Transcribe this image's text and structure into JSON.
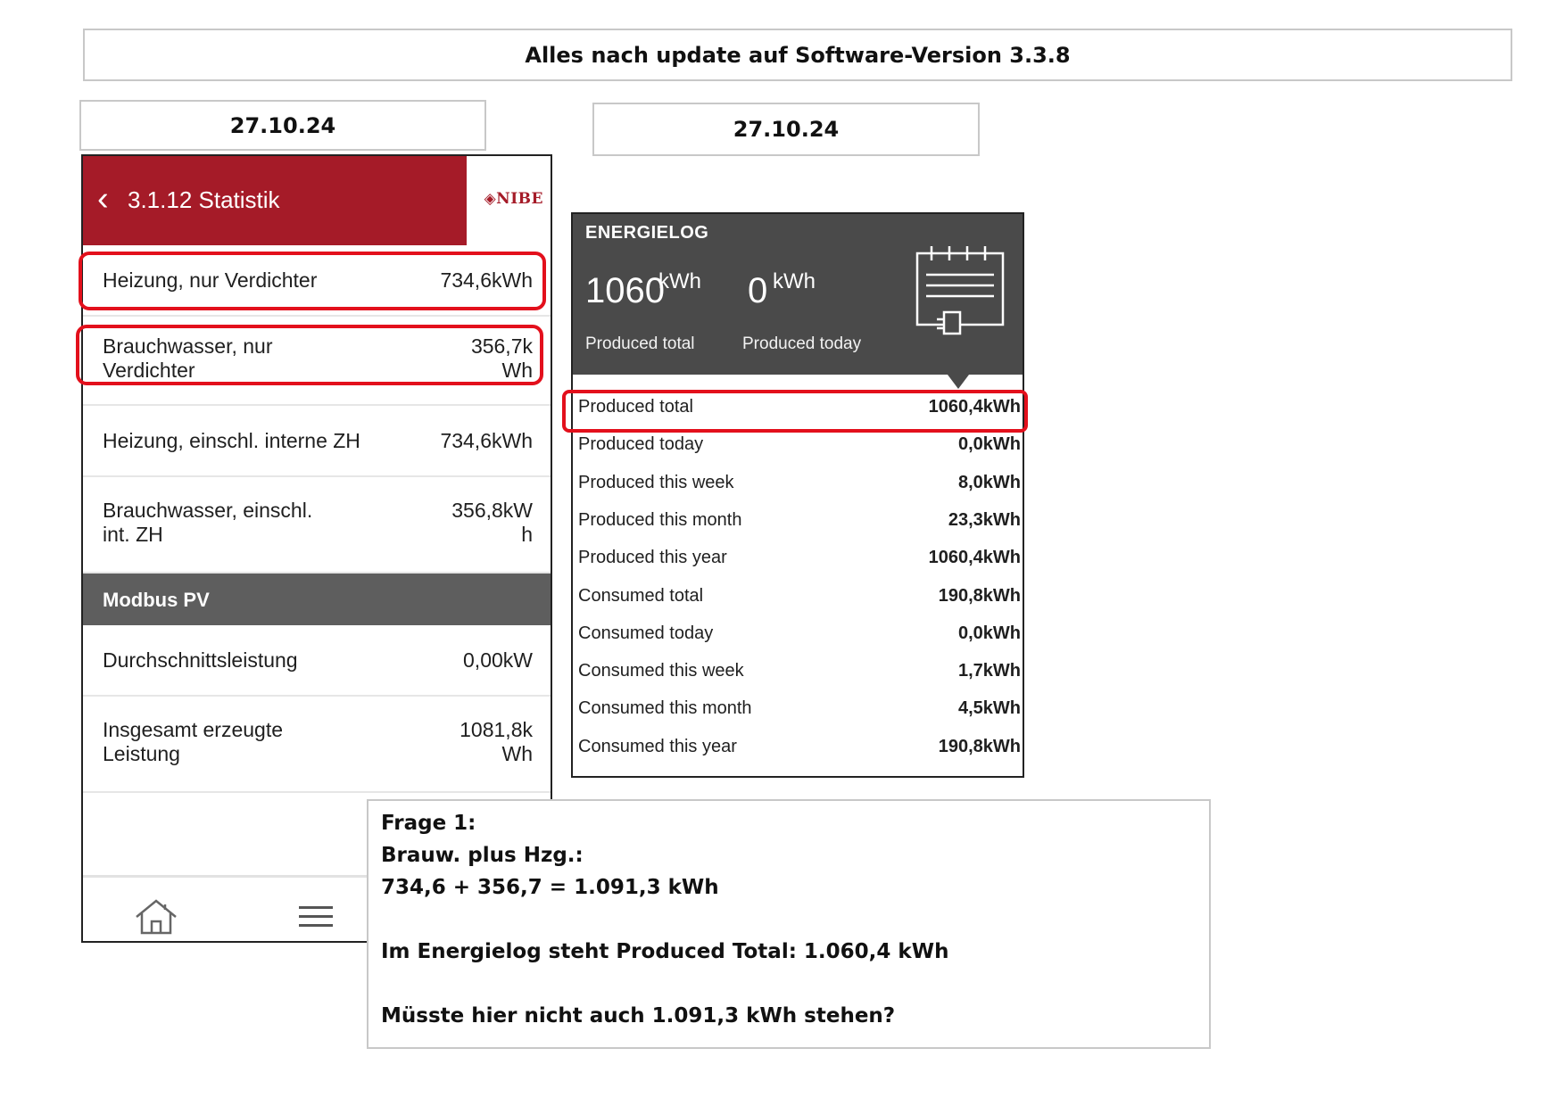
{
  "header_caption": "Alles nach update auf Software-Version 3.3.8",
  "date_left": "27.10.24",
  "date_right": "27.10.24",
  "statistik": {
    "title": "3.1.12 Statistik",
    "logo_text": "◈NIBE",
    "rows": [
      {
        "label_lines": [
          "Heizung, nur Verdichter"
        ],
        "value_lines": [
          "734,6kWh"
        ]
      },
      {
        "label_lines": [
          "Brauchwasser, nur",
          "Verdichter"
        ],
        "value_lines": [
          "356,7k",
          "Wh"
        ]
      },
      {
        "label_lines": [
          "Heizung, einschl. interne ZH"
        ],
        "value_lines": [
          "734,6kWh"
        ]
      },
      {
        "label_lines": [
          "Brauchwasser, einschl.",
          "int. ZH"
        ],
        "value_lines": [
          "356,8kW",
          "h"
        ]
      }
    ],
    "section_label": "Modbus PV",
    "pv_rows": [
      {
        "label_lines": [
          "Durchschnittsleistung"
        ],
        "value_lines": [
          "0,00kW"
        ]
      },
      {
        "label_lines": [
          "Insgesamt erzeugte",
          "Leistung"
        ],
        "value_lines": [
          "1081,8k",
          "Wh"
        ]
      }
    ]
  },
  "energielog": {
    "title": "ENERGIELOG",
    "produced_total_big": "1060",
    "produced_total_unit": "kWh",
    "produced_today_big": "0",
    "produced_today_unit": "kWh",
    "produced_total_caption": "Produced total",
    "produced_today_caption": "Produced today",
    "rows": [
      {
        "label": "Produced total",
        "value": "1060,4kWh"
      },
      {
        "label": "Produced today",
        "value": "0,0kWh"
      },
      {
        "label": "Produced this week",
        "value": "8,0kWh"
      },
      {
        "label": "Produced this month",
        "value": "23,3kWh"
      },
      {
        "label": "Produced this year",
        "value": "1060,4kWh"
      },
      {
        "label": "Consumed total",
        "value": "190,8kWh"
      },
      {
        "label": "Consumed today",
        "value": "0,0kWh"
      },
      {
        "label": "Consumed this week",
        "value": "1,7kWh"
      },
      {
        "label": "Consumed this month",
        "value": "4,5kWh"
      },
      {
        "label": "Consumed this year",
        "value": "190,8kWh"
      }
    ]
  },
  "question": {
    "line1": "Frage 1:",
    "line2": "Brauw. plus Hzg.:",
    "line3": "734,6 + 356,7 = 1.091,3 kWh",
    "line4": "Im Energielog steht Produced Total: 1.060,4 kWh",
    "line5": "Müsste hier nicht auch 1.091,3 kWh stehen?"
  },
  "icons": {
    "home": "home-icon",
    "menu": "hamburger-menu-icon",
    "back": "chevron-left-icon",
    "log": "energy-log-icon"
  },
  "colors": {
    "nibe_red": "#a51b28",
    "highlight": "#e3101c",
    "panel_dark": "#4a4a4a",
    "section_grey": "#5e5e5e"
  }
}
